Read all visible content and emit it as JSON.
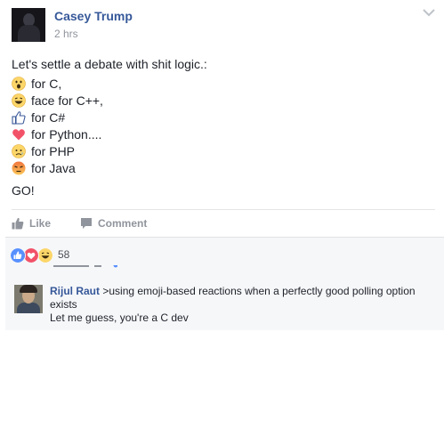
{
  "post": {
    "author": "Casey Trump",
    "time": "2 hrs",
    "intro": "Let's settle a debate with shit logic.:",
    "options": [
      {
        "reaction": "wow-emoji",
        "text": "for C,"
      },
      {
        "reaction": "haha-emoji",
        "text": "face for C++,"
      },
      {
        "reaction": "like-icon",
        "text": "for C#"
      },
      {
        "reaction": "love-heart-icon",
        "text": "for Python...."
      },
      {
        "reaction": "sad-emoji",
        "text": "for PHP"
      },
      {
        "reaction": "angry-emoji",
        "text": "for Java"
      }
    ],
    "closing": "GO!",
    "actions": {
      "like": "Like",
      "comment": "Comment"
    }
  },
  "reactions": {
    "icons": [
      "like",
      "love",
      "haha"
    ],
    "count": "58"
  },
  "comment": {
    "author": "Rijul Raut",
    "text": ">using emoji-based reactions when a perfectly good polling option exists",
    "reply": "Let me guess, you're a C dev"
  },
  "colors": {
    "link": "#365899",
    "meta": "#90949c",
    "like_blue": "#5890ff",
    "love_red": "#f25268",
    "emoji_yellow": "#fcd669",
    "angry_orange": "#f0733c"
  }
}
